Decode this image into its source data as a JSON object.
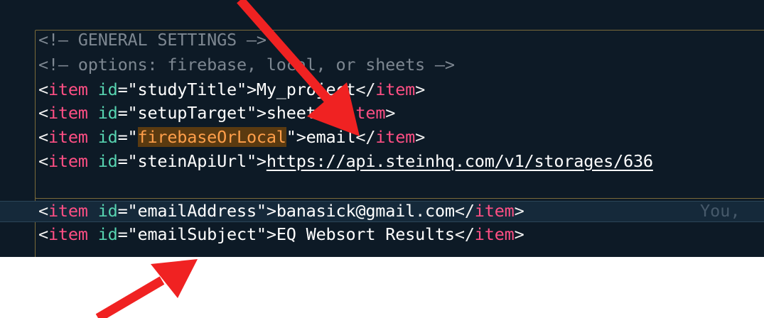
{
  "code": {
    "comment1": "<!— GENERAL SETTINGS —>",
    "comment2": "<!— options: firebase, local, or sheets —>",
    "lines": [
      {
        "id": "studyTitle",
        "value": "My_project"
      },
      {
        "id": "setupTarget",
        "value": "sheets"
      },
      {
        "id_pre": "",
        "id_highlight": "firebaseOrLocal",
        "value": "email"
      },
      {
        "id": "steinApiUrl",
        "value": "https://api.steinhq.com/v1/storages/636"
      },
      {
        "id": "emailAddress",
        "value": "banasick@gmail.com"
      },
      {
        "id": "emailSubject",
        "value": "EQ Websort Results"
      }
    ],
    "open_lt": "<",
    "tag_name": "item",
    "attr_name": "id",
    "eq_quote": "=\"",
    "quote_gt": "\">",
    "close_open": "</",
    "gt": ">",
    "blame": "You,"
  },
  "colors": {
    "background": "#0d1a26",
    "tag": "#ff4f84",
    "attribute": "#57d3b0",
    "comment": "#7d8791",
    "annotation_arrow": "#f02222"
  },
  "annotations": [
    "arrow-pointing-to-setupTarget-value",
    "arrow-pointing-to-emailSubject"
  ]
}
